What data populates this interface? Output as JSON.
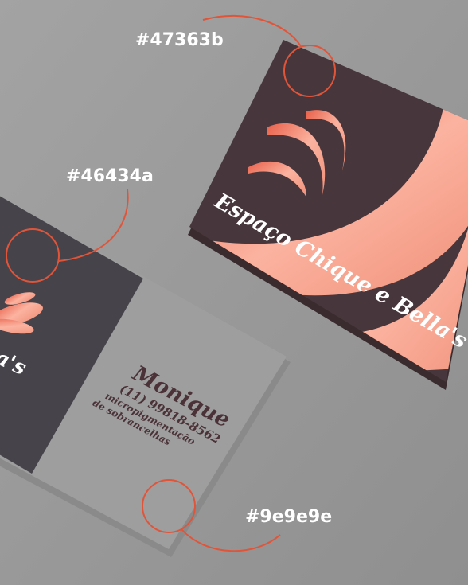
{
  "swatches": [
    {
      "label": "#47363b",
      "color": "#47363b"
    },
    {
      "label": "#46434a",
      "color": "#46434a"
    },
    {
      "label": "#9e9e9e",
      "color": "#9e9e9e"
    }
  ],
  "front_card": {
    "brand": "Espaço Chique e Bella's",
    "accent": "#f5a08a"
  },
  "back_card": {
    "brand_fragment": "a's",
    "name": "Monique",
    "phone": "(11) 99818-8562",
    "service_line1": "micropigmentação",
    "service_line2": "de  sobrancelhas"
  },
  "callout_color": "#e0553a"
}
